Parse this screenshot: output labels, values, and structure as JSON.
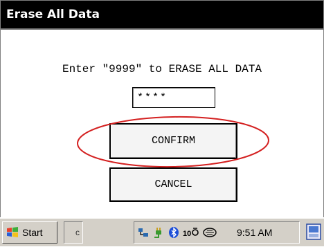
{
  "window": {
    "title": "Erase All Data"
  },
  "dialog": {
    "prompt": "Enter \"9999\" to ERASE ALL DATA",
    "code_value": "****",
    "confirm_label": "CONFIRM",
    "cancel_label": "CANCEL"
  },
  "annotation": {
    "color": "#d42020"
  },
  "taskbar": {
    "start_label": "Start",
    "task_slot_text": "c",
    "clock": "9:51 AM",
    "tray_icons": [
      "network-icon",
      "plug-icon",
      "bluetooth-icon",
      "wireless-icon",
      "connection-icon"
    ]
  }
}
